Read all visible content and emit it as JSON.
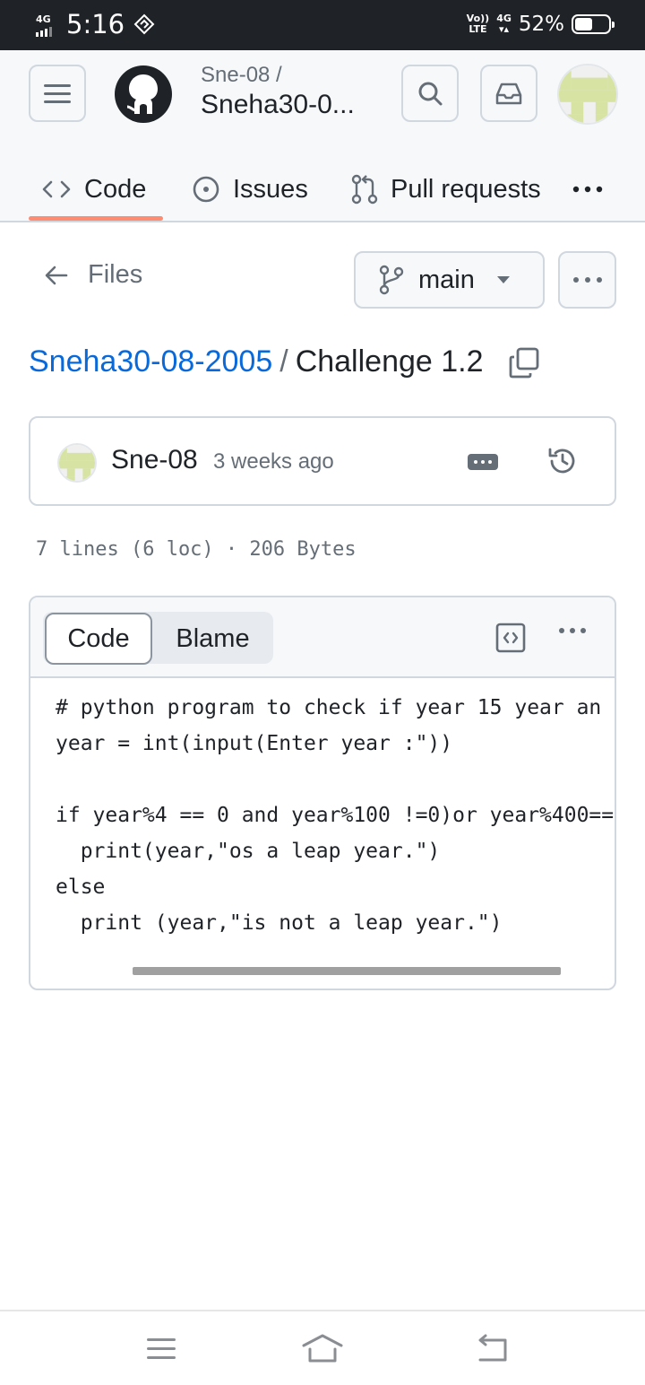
{
  "status_bar": {
    "network_type": "4G",
    "time": "5:16",
    "volte_top": "Vo))",
    "volte_bottom": "LTE",
    "data_type": "4G",
    "battery_percent": "52%",
    "battery_level": 0.52
  },
  "header": {
    "repo_owner": "Sne-08 /",
    "repo_name": "Sneha30-0..."
  },
  "tabs": [
    {
      "label": "Code",
      "active": true
    },
    {
      "label": "Issues"
    },
    {
      "label": "Pull requests"
    }
  ],
  "files_nav": {
    "back_label": "Files",
    "branch": "main"
  },
  "breadcrumb": {
    "repo": "Sneha30-08-2005",
    "separator": "/",
    "file": "Challenge 1.2"
  },
  "commit": {
    "author": "Sne-08",
    "time_ago": "3 weeks ago"
  },
  "file_info": "7 lines (6 loc) · 206 Bytes",
  "code_view": {
    "tabs": [
      "Code",
      "Blame"
    ],
    "active_tab": "Code",
    "lines": [
      "# python program to check if year 15 year an",
      "year = int(input(Enter year :\"))",
      "",
      "if year%4 == 0 and year%100 !=0)or year%400==",
      "  print(year,\"os a leap year.\")",
      "else",
      "  print (year,\"is not a leap year.\")"
    ]
  },
  "colors": {
    "accent_link": "#0969da",
    "tab_underline": "#fd8c73",
    "border": "#d0d7de",
    "header_bg": "#f6f8fa",
    "avatar": "#d6e3a3"
  },
  "icons": [
    "hamburger-icon",
    "github-logo-icon",
    "search-icon",
    "inbox-icon",
    "code-icon",
    "issue-icon",
    "pull-request-icon",
    "kebab-icon",
    "arrow-left-icon",
    "git-branch-icon",
    "triangle-down-icon",
    "copy-icon",
    "history-icon",
    "raw-file-icon",
    "nav-menu-icon",
    "nav-home-icon",
    "nav-back-icon"
  ]
}
